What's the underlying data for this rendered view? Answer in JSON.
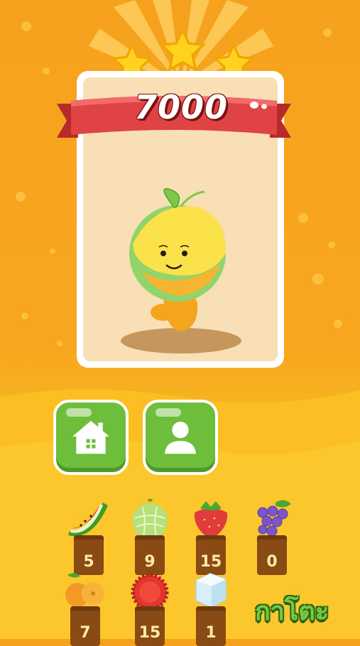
{
  "score": "7000",
  "stars_earned": 3,
  "stars_total": 3,
  "buttons": {
    "home": "home-icon",
    "profile": "user-icon"
  },
  "fruits": [
    {
      "name": "watermelon",
      "icon": "watermelon-icon",
      "count": "5"
    },
    {
      "name": "melon",
      "icon": "melon-icon",
      "count": "9"
    },
    {
      "name": "strawberry",
      "icon": "strawberry-icon",
      "count": "15"
    },
    {
      "name": "grape",
      "icon": "grape-icon",
      "count": "0"
    },
    {
      "name": "orange",
      "icon": "orange-icon",
      "count": "7"
    },
    {
      "name": "rambutan",
      "icon": "rambutan-icon",
      "count": "15"
    },
    {
      "name": "ice",
      "icon": "ice-cube-icon",
      "count": "1"
    }
  ],
  "logo_text": "กาโตะ",
  "colors": {
    "background": "#f7a21e",
    "ribbon": "#d83a3a",
    "button_green": "#6fbe3b",
    "stump": "#8a4a14"
  }
}
